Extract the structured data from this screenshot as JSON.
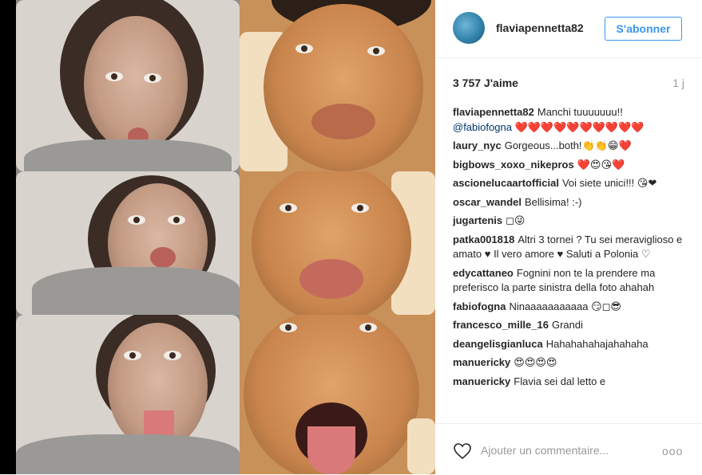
{
  "post": {
    "username": "flaviapennetta82",
    "follow_label": "S'abonner",
    "likes": "3 757 J'aime",
    "time": "1 j"
  },
  "comments": [
    {
      "user": "flaviapennetta82",
      "text": "Manchi tuuuuuuu!!",
      "tag": "@fabiofogna",
      "after": "❤️❤️❤️❤️❤️❤️❤️❤️❤️❤️"
    },
    {
      "user": "laury_nyc",
      "text": "Gorgeous...both!👏👏😁❤️"
    },
    {
      "user": "bigbows_xoxo_nikepros",
      "text": "❤️😍😘❤️"
    },
    {
      "user": "ascionelucaartofficial",
      "text": "Voi siete unici!!! 😘❤"
    },
    {
      "user": "oscar_wandel",
      "text": "Bellisima! :-)"
    },
    {
      "user": "jugartenis",
      "text": "◻😜"
    },
    {
      "user": "patka001818",
      "text": "Altri 3 tornei ? Tu sei meraviglioso e amato ♥ Il vero amore ♥ Saluti a Polonia ♡"
    },
    {
      "user": "edycattaneo",
      "text": "Fognini non te la prendere ma preferisco la parte sinistra della foto ahahah"
    },
    {
      "user": "fabiofogna",
      "text": "Ninaaaaaaaaaaa 😏◻😎"
    },
    {
      "user": "francesco_mille_16",
      "text": "Grandi"
    },
    {
      "user": "deangelisgianluca",
      "text": "Hahahahahajahahaha"
    },
    {
      "user": "manuericky",
      "text": "😍😍😍😍"
    },
    {
      "user": "manuericky",
      "text": "Flavia sei dal letto e"
    }
  ],
  "footer": {
    "placeholder": "Ajouter un commentaire...",
    "more_label": "ooo"
  }
}
